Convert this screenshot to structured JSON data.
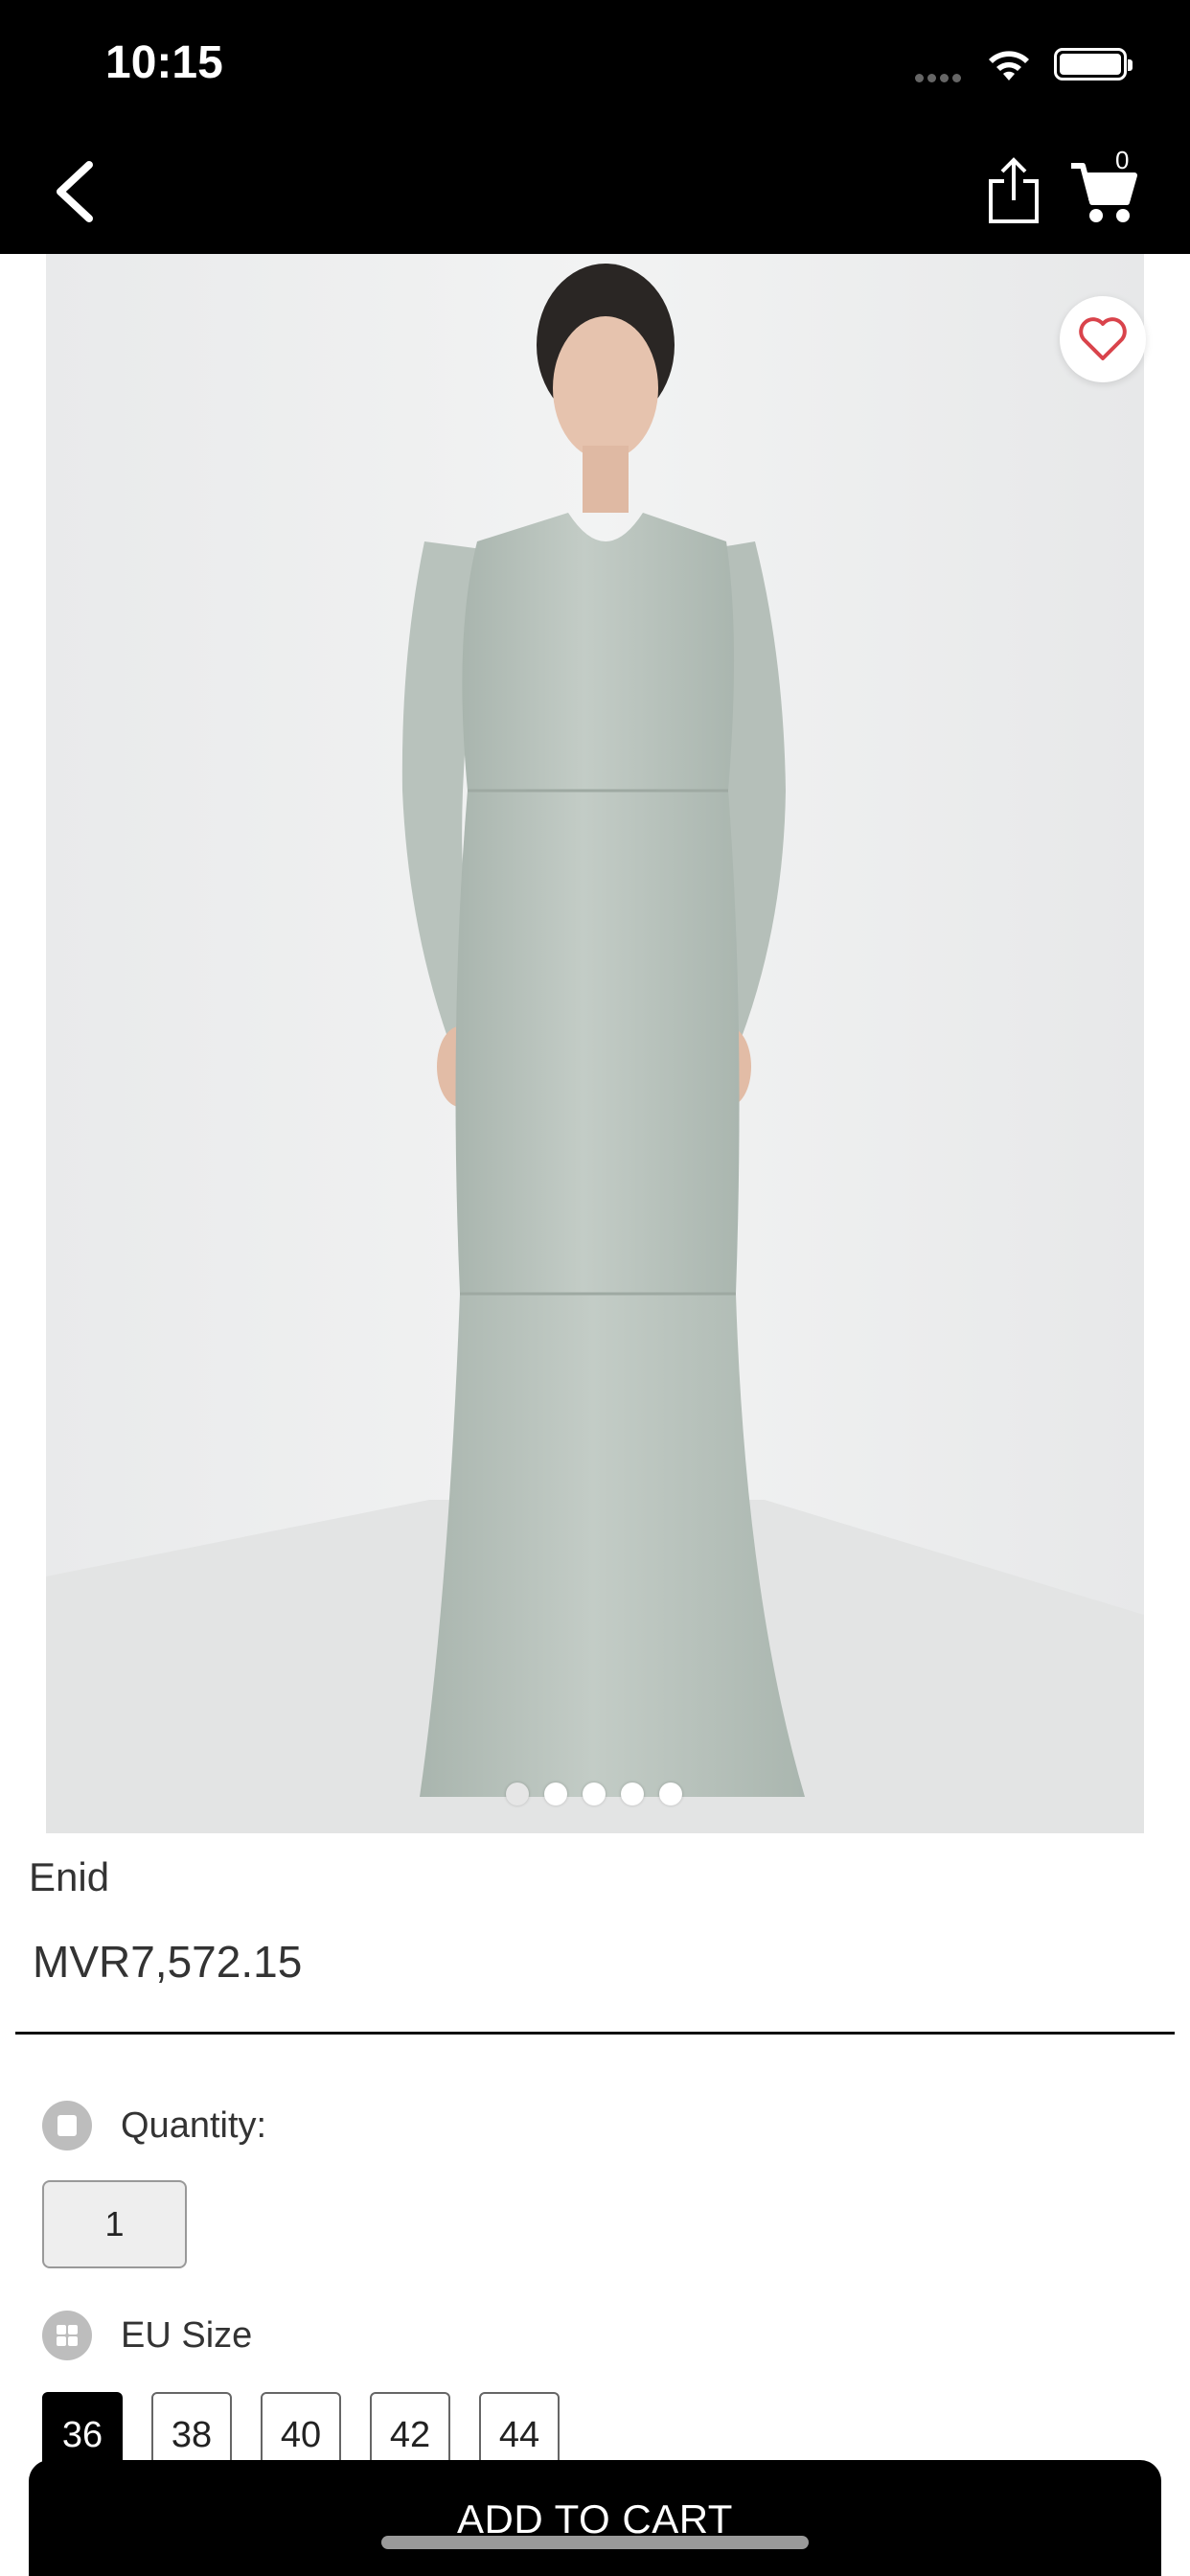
{
  "status_bar": {
    "time": "10:15"
  },
  "nav": {
    "cart_count": "0"
  },
  "product": {
    "name": "Enid",
    "price": "MVR7,572.15",
    "image_description_icon": "dress-photo",
    "carousel": {
      "count": 5,
      "active_index": 0
    }
  },
  "options": {
    "quantity_label": "Quantity:",
    "quantity_value": "1",
    "size_label": "EU Size",
    "sizes": [
      "36",
      "38",
      "40",
      "42",
      "44"
    ],
    "selected_size": "36"
  },
  "actions": {
    "add_to_cart": "ADD TO CART"
  },
  "colors": {
    "accent": "#000000",
    "favorite": "#d9434b",
    "dress": "#b9c4bd"
  }
}
